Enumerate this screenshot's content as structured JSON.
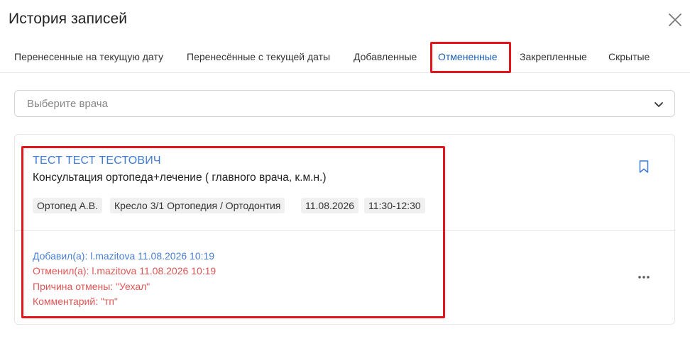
{
  "modal": {
    "title": "История записей",
    "close_icon": "close-icon"
  },
  "tabs": [
    {
      "label": "Перенесенные на текущую дату",
      "active": false
    },
    {
      "label": "Перенесённые с текущей даты",
      "active": false
    },
    {
      "label": "Добавленные",
      "active": false
    },
    {
      "label": "Отмененные",
      "active": true
    },
    {
      "label": "Закрепленные",
      "active": false
    },
    {
      "label": "Скрытые",
      "active": false
    }
  ],
  "doctor_select": {
    "placeholder": "Выберите врача",
    "icon": "chevron-down-icon"
  },
  "record": {
    "patient_name": "ТЕСТ ТЕСТ ТЕСТОВИЧ",
    "service": "Консультация ортопеда+лечение ( главного врача, к.м.н.)",
    "tags": [
      "Ортопед А.В.",
      "Кресло 3/1 Ортопедия / Ортодонтия",
      "11.08.2026",
      "11:30-12:30"
    ],
    "added_by": "Добавил(а): l.mazitova 11.08.2026 10:19",
    "cancelled_by": "Отменил(а): l.mazitova 11.08.2026 10:19",
    "cancel_reason": "Причина отмены: \"Уехал\"",
    "comment": "Комментарий: \"тп\"",
    "bookmark_icon": "bookmark-icon",
    "more_icon": "more-horizontal-icon"
  },
  "colors": {
    "accent": "#1a5fb4",
    "link": "#3d7bd6",
    "added_text": "#4a7fd0",
    "cancel_text": "#e05555",
    "highlight_frame": "#e3141b"
  }
}
